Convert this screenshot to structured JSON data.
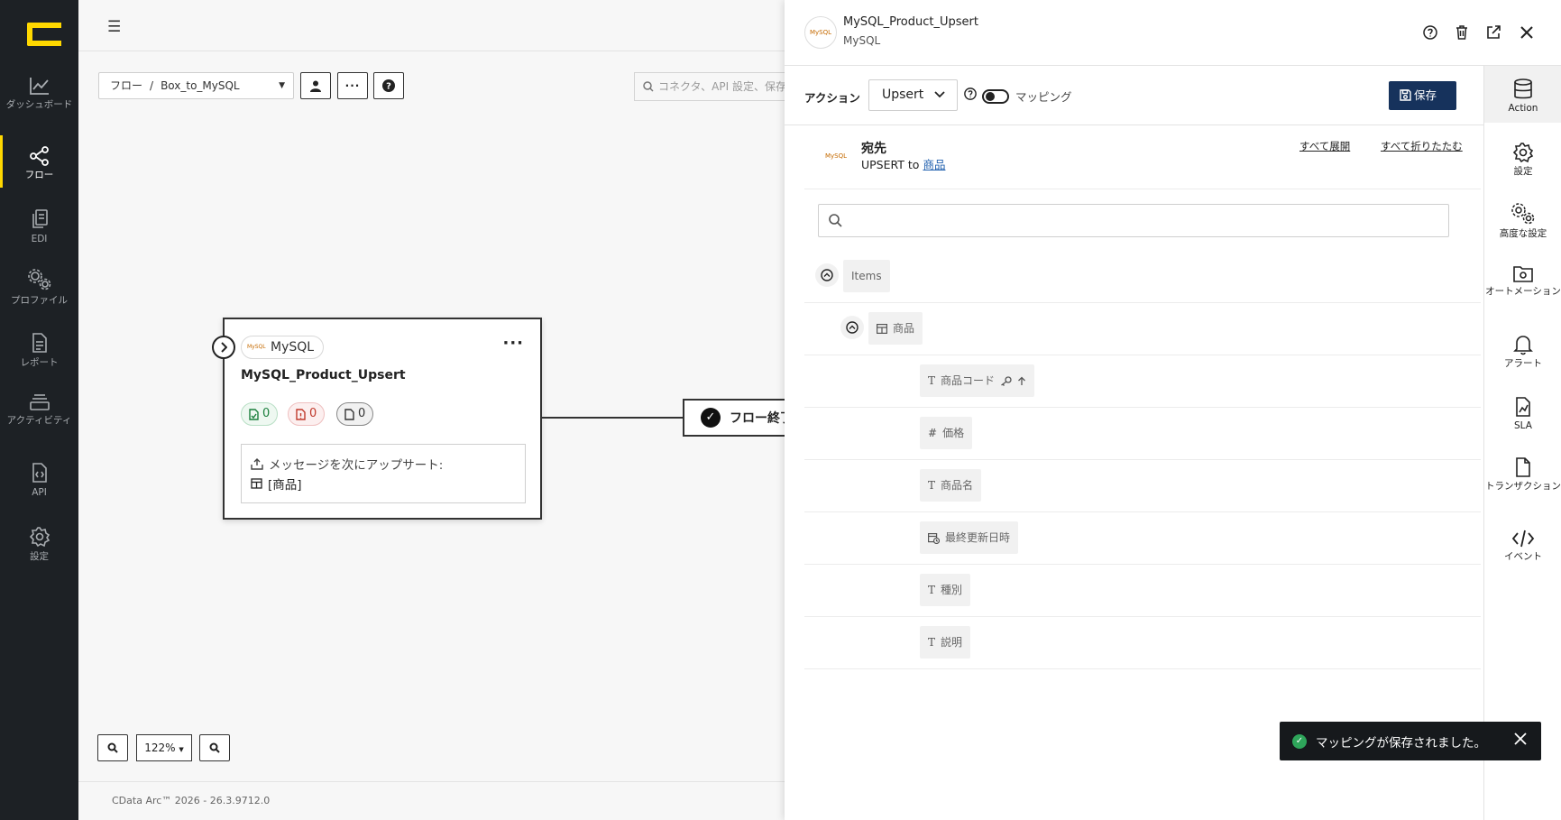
{
  "sidebar": {
    "items": [
      {
        "label": "ダッシュボード",
        "icon": "dashboard-icon"
      },
      {
        "label": "フロー",
        "icon": "flow-icon",
        "active": true
      },
      {
        "label": "EDI",
        "icon": "edi-icon"
      },
      {
        "label": "プロファイル",
        "icon": "profile-icon"
      },
      {
        "label": "レポート",
        "icon": "report-icon"
      },
      {
        "label": "アクティビティ",
        "icon": "activity-icon"
      },
      {
        "label": "API",
        "icon": "api-icon"
      },
      {
        "label": "設定",
        "icon": "settings-icon"
      }
    ]
  },
  "main": {
    "breadcrumb_root": "フロー",
    "breadcrumb_sep": "/",
    "breadcrumb_current": "Box_to_MySQL",
    "search_placeholder": "コネクタ、API 設定、保存",
    "node": {
      "connector": "MySQL",
      "connector_logo": "MySQL",
      "title": "MySQL_Product_Upsert",
      "success_count": "0",
      "error_count": "0",
      "pending_count": "0",
      "body_line1": "メッセージを次にアップサート:",
      "body_line2": "[商品]"
    },
    "flow_end_label": "フロー終了",
    "zoom_level": "122%",
    "footer": "CData Arc™ 2026 - 26.3.9712.0"
  },
  "panel": {
    "title": "MySQL_Product_Upsert",
    "subtitle": "MySQL",
    "avatar_text": "MySQL",
    "action_label": "アクション",
    "action_value": "Upsert",
    "toggle_label": "マッピング",
    "save_label": "保存",
    "dest_title": "宛先",
    "dest_sub_prefix": "UPSERT to",
    "dest_sub_link": "商品",
    "expand_all": "すべて展開",
    "collapse_all": "すべて折りたたむ",
    "tree": {
      "root": "Items",
      "table": "商品",
      "fields": [
        {
          "name": "商品コード",
          "type": "T"
        },
        {
          "name": "価格",
          "type": "#"
        },
        {
          "name": "商品名",
          "type": "T"
        },
        {
          "name": "最終更新日時",
          "type": "date"
        },
        {
          "name": "種別",
          "type": "T"
        },
        {
          "name": "説明",
          "type": "T"
        }
      ]
    },
    "rail": [
      {
        "label": "Action",
        "icon": "database-icon"
      },
      {
        "label": "設定",
        "icon": "gear-icon"
      },
      {
        "label": "高度な設定",
        "icon": "gears-icon"
      },
      {
        "label": "オートメーション",
        "icon": "automation-icon"
      },
      {
        "label": "アラート",
        "icon": "bell-icon"
      },
      {
        "label": "SLA",
        "icon": "sla-icon"
      },
      {
        "label": "トランザクション",
        "icon": "transaction-icon"
      },
      {
        "label": "イベント",
        "icon": "code-icon"
      }
    ]
  },
  "toast": {
    "message": "マッピングが保存されました。"
  },
  "colors": {
    "sidebar_bg": "#1d2125",
    "accent_yellow": "#ffd800",
    "save_button": "#16325c",
    "toast_bg": "#16191c",
    "success_green": "#2ea55a"
  }
}
